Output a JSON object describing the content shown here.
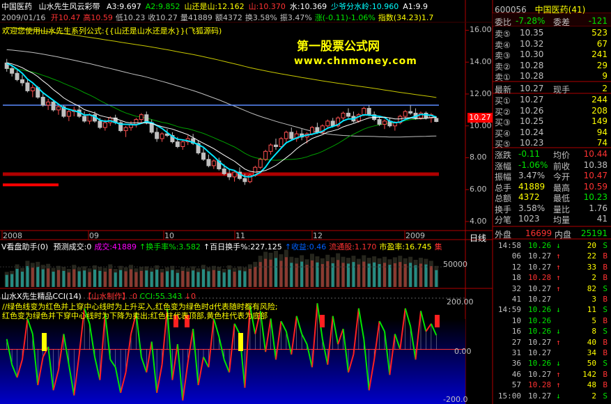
{
  "header": {
    "stock_name": "中国医药",
    "indicator_name": "山水先生风云彩带",
    "parts": [
      {
        "text": "A3:9.697",
        "color": "#ffffff"
      },
      {
        "text": "A2:9.852",
        "color": "#00e600"
      },
      {
        "text": "山还是山:12.162",
        "color": "#ffff00"
      },
      {
        "text": "山:10.370",
        "color": "#ff3232"
      },
      {
        "text": "水:10.369",
        "color": "#ffffff"
      },
      {
        "text": "少爷分水岭:10.960",
        "color": "#00ffff"
      },
      {
        "text": "A1:9.9",
        "color": "#ffffff"
      }
    ],
    "date": "2009/01/16",
    "ohlc": [
      {
        "text": "开10.47",
        "color": "#ff3232"
      },
      {
        "text": "高10.59",
        "color": "#ff3232"
      },
      {
        "text": "低10.23",
        "color": "#c0c0c0"
      },
      {
        "text": "收10.27",
        "color": "#c0c0c0"
      },
      {
        "text": "量41889",
        "color": "#c0c0c0"
      },
      {
        "text": "额4372",
        "color": "#c0c0c0"
      },
      {
        "text": "换3.58%",
        "color": "#c0c0c0"
      },
      {
        "text": "振3.47%",
        "color": "#c0c0c0"
      },
      {
        "text": "涨(-0.11)-1.06%",
        "color": "#00e600"
      },
      {
        "text": "指数(34.23)1.7",
        "color": "#ffff00"
      }
    ],
    "welcome": "欢迎您使用山水先生系列公式:{{山还是山水还是水}}(飞狐源码)",
    "watermark_title": "第一股票公式网",
    "watermark_url": "www.chnmoney.com",
    "current_price_tag": "10.27"
  },
  "price_axis": [
    "16.00",
    "14.00",
    "12.00",
    "10.00",
    "8.00",
    "6.00",
    "4.00"
  ],
  "x_axis": {
    "labels": [
      "2008",
      "09",
      "10",
      "11",
      "12",
      "2009"
    ],
    "period": "日线"
  },
  "volume_panel": {
    "title": "V看盘助手(0)",
    "parts": [
      {
        "text": "预测成交:0",
        "color": "#ffffff"
      },
      {
        "text": "成交:41889",
        "color": "#ff00ff"
      },
      {
        "text": "↑换手率%:3.582",
        "color": "#00e600"
      },
      {
        "text": "↑百日换手%:227.125",
        "color": "#ffffff"
      },
      {
        "text": "↑收益:0.46",
        "color": "#0060ff"
      },
      {
        "text": "流通股:1.170",
        "color": "#ff3232"
      },
      {
        "text": "市盈率:16.745",
        "color": "#ffff00"
      },
      {
        "text": "集",
        "color": "#ff3232"
      }
    ],
    "axis_label": "50000"
  },
  "cci_panel": {
    "title": "山水X先生精品CCI(14)",
    "maker": "【山水制作】",
    "maker_value": ":0",
    "cci_value": "CCI:55.343",
    "cci_suffix": "↓0",
    "note1": "//绿色线变为红色并上穿中心线时为上升买入,红色变为绿色时d代表随时都有风险;",
    "note2": "红色变为绿色并下穿中心线时为下降为卖出;红色柱代表顶部,黄色柱代表为底部",
    "axis": [
      "200.00",
      "0.00",
      "-200.0"
    ]
  },
  "quote": {
    "code": "600056",
    "name": "中国医药(41)",
    "weibi_label": "委比",
    "weibi_value": "-7.28%",
    "weicha_label": "委差",
    "weicha_value": "-121",
    "asks": [
      {
        "label": "卖⑤",
        "price": "10.35",
        "vol": "523"
      },
      {
        "label": "卖④",
        "price": "10.32",
        "vol": "67"
      },
      {
        "label": "卖③",
        "price": "10.30",
        "vol": "241"
      },
      {
        "label": "卖②",
        "price": "10.28",
        "vol": "29"
      },
      {
        "label": "卖①",
        "price": "10.28",
        "vol": "9"
      }
    ],
    "latest_label": "最新",
    "latest_value": "10.27",
    "cur_hand_label": "现手",
    "cur_hand_value": "2",
    "bids": [
      {
        "label": "买①",
        "price": "10.27",
        "vol": "244"
      },
      {
        "label": "买②",
        "price": "10.26",
        "vol": "208"
      },
      {
        "label": "买③",
        "price": "10.25",
        "vol": "149"
      },
      {
        "label": "买④",
        "price": "10.24",
        "vol": "94"
      },
      {
        "label": "买⑤",
        "price": "10.23",
        "vol": "74"
      }
    ],
    "stats": [
      {
        "l1": "涨跌",
        "v1": "-0.11",
        "c1": "#00e600",
        "l2": "均价",
        "v2": "10.44",
        "c2": "#ff3232"
      },
      {
        "l1": "涨幅",
        "v1": "-1.06%",
        "c1": "#00e600",
        "l2": "前收",
        "v2": "10.38",
        "c2": "#c0c0c0"
      },
      {
        "l1": "振幅",
        "v1": "3.47%",
        "c1": "#c0c0c0",
        "l2": "今开",
        "v2": "10.47",
        "c2": "#ff3232"
      },
      {
        "l1": "总手",
        "v1": "41889",
        "c1": "#ffff00",
        "l2": "最高",
        "v2": "10.59",
        "c2": "#ff3232"
      },
      {
        "l1": "总额",
        "v1": "4372",
        "c1": "#ffff00",
        "l2": "最低",
        "v2": "10.23",
        "c2": "#00e600"
      },
      {
        "l1": "换手",
        "v1": "3.58%",
        "c1": "#c0c0c0",
        "l2": "量比",
        "v2": "1.76",
        "c2": "#c0c0c0"
      },
      {
        "l1": "分笔",
        "v1": "1023",
        "c1": "#c0c0c0",
        "l2": "均量",
        "v2": "41",
        "c2": "#c0c0c0"
      }
    ],
    "outer_label": "外盘",
    "outer_value": "16699",
    "inner_label": "内盘",
    "inner_value": "25191"
  },
  "ticks": [
    {
      "time": "14:58",
      "price": "10.26",
      "arrow": "↓",
      "vol": "20",
      "side": "S",
      "pc": "#00e600"
    },
    {
      "time": "06",
      "price": "10.27",
      "arrow": "↑",
      "vol": "22",
      "side": "B",
      "pc": "#c0c0c0"
    },
    {
      "time": "12",
      "price": "10.27",
      "arrow": "↑",
      "vol": "33",
      "side": "B",
      "pc": "#c0c0c0"
    },
    {
      "time": "18",
      "price": "10.28",
      "arrow": "↑",
      "vol": "2",
      "side": "B",
      "pc": "#ff3232"
    },
    {
      "time": "32",
      "price": "10.27",
      "arrow": "↑",
      "vol": "82",
      "side": "S",
      "pc": "#c0c0c0"
    },
    {
      "time": "41",
      "price": "10.27",
      "arrow": "",
      "vol": "3",
      "side": "B",
      "pc": "#c0c0c0"
    },
    {
      "time": "14:59",
      "price": "10.26",
      "arrow": "↓",
      "vol": "11",
      "side": "S",
      "pc": "#00e600"
    },
    {
      "time": "10",
      "price": "10.26",
      "arrow": "",
      "vol": "5",
      "side": "B",
      "pc": "#00e600"
    },
    {
      "time": "16",
      "price": "10.26",
      "arrow": "↓",
      "vol": "8",
      "side": "S",
      "pc": "#00e600"
    },
    {
      "time": "27",
      "price": "10.27",
      "arrow": "↑",
      "vol": "40",
      "side": "B",
      "pc": "#c0c0c0"
    },
    {
      "time": "31",
      "price": "10.27",
      "arrow": "",
      "vol": "34",
      "side": "B",
      "pc": "#c0c0c0"
    },
    {
      "time": "36",
      "price": "10.26",
      "arrow": "↓",
      "vol": "50",
      "side": "S",
      "pc": "#00e600"
    },
    {
      "time": "46",
      "price": "10.27",
      "arrow": "↑",
      "vol": "142",
      "side": "B",
      "pc": "#c0c0c0"
    },
    {
      "time": "57",
      "price": "10.28",
      "arrow": "↑",
      "vol": "48",
      "side": "B",
      "pc": "#ff3232"
    },
    {
      "time": "15:00",
      "price": "10.27",
      "arrow": "↓",
      "vol": "2",
      "side": "S",
      "pc": "#c0c0c0"
    }
  ],
  "chart_data": {
    "type": "line",
    "description_of_marks": "candlestick price series with moving-average ribbons",
    "candles": [
      [
        13.95,
        14.2,
        13.4,
        13.6
      ],
      [
        13.6,
        13.8,
        13.1,
        13.3
      ],
      [
        13.3,
        13.5,
        12.8,
        12.9
      ],
      [
        12.9,
        13.2,
        12.5,
        12.7
      ],
      [
        12.7,
        12.9,
        12.1,
        12.2
      ],
      [
        12.2,
        12.6,
        11.8,
        12.4
      ],
      [
        12.4,
        12.5,
        11.7,
        11.8
      ],
      [
        11.8,
        12.1,
        11.2,
        11.3
      ],
      [
        11.3,
        11.7,
        11.0,
        11.5
      ],
      [
        11.5,
        11.6,
        10.9,
        11.0
      ],
      [
        11.0,
        11.4,
        10.7,
        11.2
      ],
      [
        11.2,
        11.3,
        10.5,
        10.6
      ],
      [
        10.6,
        11.0,
        10.3,
        10.9
      ],
      [
        10.9,
        11.2,
        10.6,
        11.0
      ],
      [
        11.0,
        11.3,
        10.5,
        10.6
      ],
      [
        10.6,
        10.9,
        10.2,
        10.3
      ],
      [
        10.3,
        10.8,
        10.1,
        10.7
      ],
      [
        10.7,
        10.9,
        10.2,
        10.3
      ],
      [
        10.3,
        10.5,
        9.8,
        9.9
      ],
      [
        9.9,
        10.4,
        9.7,
        10.2
      ],
      [
        10.2,
        10.6,
        10.0,
        10.5
      ],
      [
        10.5,
        10.7,
        10.1,
        10.2
      ],
      [
        10.2,
        10.3,
        9.6,
        9.7
      ],
      [
        9.7,
        10.0,
        9.3,
        9.9
      ],
      [
        9.9,
        10.3,
        9.7,
        10.1
      ],
      [
        10.1,
        10.5,
        9.9,
        10.4
      ],
      [
        10.4,
        10.8,
        10.2,
        10.7
      ],
      [
        10.7,
        10.9,
        10.1,
        10.2
      ],
      [
        10.2,
        10.4,
        9.5,
        9.6
      ],
      [
        9.6,
        9.9,
        9.0,
        9.2
      ],
      [
        9.2,
        9.6,
        9.0,
        9.5
      ],
      [
        9.5,
        9.8,
        9.3,
        9.4
      ],
      [
        9.4,
        9.6,
        8.9,
        9.0
      ],
      [
        9.0,
        9.3,
        8.6,
        8.7
      ],
      [
        8.7,
        9.1,
        8.5,
        9.0
      ],
      [
        9.0,
        9.4,
        8.8,
        9.2
      ],
      [
        9.2,
        9.5,
        8.8,
        8.9
      ],
      [
        8.9,
        9.1,
        8.2,
        8.3
      ],
      [
        8.3,
        8.6,
        7.8,
        7.9
      ],
      [
        7.9,
        8.2,
        7.4,
        7.5
      ],
      [
        7.5,
        7.9,
        7.3,
        7.8
      ],
      [
        7.8,
        8.0,
        7.2,
        7.3
      ],
      [
        7.3,
        7.6,
        6.9,
        7.0
      ],
      [
        7.0,
        7.3,
        6.6,
        6.8
      ],
      [
        6.8,
        7.2,
        6.5,
        7.1
      ],
      [
        7.1,
        7.4,
        6.6,
        6.7
      ],
      [
        6.7,
        7.0,
        6.3,
        6.5
      ],
      [
        6.5,
        7.0,
        6.4,
        6.9
      ],
      [
        6.9,
        7.5,
        6.8,
        7.4
      ],
      [
        7.4,
        8.0,
        7.3,
        7.9
      ],
      [
        7.9,
        8.5,
        7.8,
        8.4
      ],
      [
        8.4,
        8.9,
        8.2,
        8.8
      ],
      [
        8.8,
        9.2,
        8.5,
        8.7
      ],
      [
        8.7,
        9.3,
        8.6,
        9.2
      ],
      [
        9.2,
        9.7,
        9.0,
        9.6
      ],
      [
        9.6,
        9.9,
        9.1,
        9.2
      ],
      [
        9.2,
        9.7,
        9.0,
        9.5
      ],
      [
        9.5,
        9.8,
        9.1,
        9.3
      ],
      [
        9.3,
        9.6,
        8.9,
        9.5
      ],
      [
        9.5,
        10.0,
        9.4,
        9.9
      ],
      [
        9.9,
        10.2,
        9.5,
        9.6
      ],
      [
        9.6,
        10.1,
        9.5,
        10.0
      ],
      [
        10.0,
        10.4,
        9.8,
        10.3
      ],
      [
        10.3,
        10.5,
        9.9,
        10.0
      ],
      [
        10.0,
        10.6,
        9.9,
        10.5
      ],
      [
        10.5,
        10.9,
        10.3,
        10.8
      ],
      [
        10.8,
        11.1,
        10.5,
        10.6
      ],
      [
        10.6,
        10.9,
        10.2,
        10.3
      ],
      [
        10.3,
        10.8,
        10.2,
        10.7
      ],
      [
        10.7,
        11.2,
        10.6,
        11.1
      ],
      [
        11.1,
        11.3,
        10.6,
        10.7
      ],
      [
        10.7,
        10.9,
        10.3,
        10.4
      ],
      [
        10.4,
        10.6,
        10.0,
        10.1
      ],
      [
        10.1,
        10.4,
        9.8,
        10.3
      ],
      [
        10.3,
        10.5,
        9.9,
        10.0
      ],
      [
        10.0,
        10.3,
        9.7,
        10.2
      ],
      [
        10.2,
        10.7,
        10.1,
        10.6
      ],
      [
        10.6,
        11.0,
        10.4,
        10.9
      ],
      [
        10.9,
        11.3,
        10.7,
        10.8
      ],
      [
        10.8,
        11.1,
        10.4,
        10.5
      ],
      [
        10.5,
        10.9,
        10.4,
        10.8
      ],
      [
        10.8,
        10.9,
        10.4,
        10.5
      ],
      [
        10.5,
        10.8,
        10.2,
        10.7
      ],
      [
        10.47,
        10.59,
        10.23,
        10.27
      ]
    ],
    "volumes": [
      30000,
      32000,
      45000,
      38000,
      52000,
      48000,
      50000,
      44000,
      46000,
      38000,
      42000,
      40000,
      36000,
      44000,
      39000,
      41000,
      37000,
      43000,
      40000,
      38000,
      45000,
      36000,
      42000,
      39000,
      44000,
      37000,
      40000,
      41000,
      38000,
      43000,
      36000,
      39000,
      42000,
      35000,
      40000,
      38000,
      41000,
      37000,
      44000,
      39000,
      42000,
      40000,
      36000,
      43000,
      38000,
      41000,
      39000,
      45000,
      50000,
      62000,
      70000,
      68000,
      72000,
      65000,
      74000,
      60000,
      58000,
      63000,
      55000,
      66000,
      61000,
      57000,
      64000,
      59000,
      67000,
      60000,
      58000,
      62000,
      56000,
      63000,
      58000,
      61000,
      57000,
      60000,
      55000,
      59000,
      62000,
      57000,
      60000,
      54000,
      58000,
      56000,
      52000,
      41889
    ],
    "cci": [
      40,
      -60,
      -110,
      -40,
      120,
      60,
      -140,
      -30,
      10,
      -160,
      -80,
      60,
      -60,
      -180,
      -20,
      160,
      100,
      -30,
      -120,
      140,
      -40,
      -70,
      -170,
      -90,
      60,
      140,
      -30,
      -90,
      30,
      -170,
      -60,
      160,
      -120,
      20,
      -200,
      -50,
      80,
      -140,
      -30,
      -70,
      120,
      50,
      -40,
      -90,
      100,
      60,
      -150,
      170,
      60,
      150,
      -10,
      120,
      -40,
      110,
      70,
      -20,
      130,
      60,
      20,
      -70,
      180,
      40,
      -60,
      130,
      20,
      80,
      -90,
      -20,
      160,
      40,
      -160,
      -40,
      110,
      70,
      -100,
      60,
      0,
      160,
      90,
      -40,
      150,
      70,
      100,
      55
    ],
    "price_ylim": [
      4,
      16.5
    ],
    "cci_ylim": [
      -200,
      200
    ],
    "x_labels": [
      "2008",
      "09",
      "10",
      "11",
      "12",
      "2009"
    ],
    "ma_periods": [
      5,
      10,
      20,
      60,
      120
    ]
  }
}
